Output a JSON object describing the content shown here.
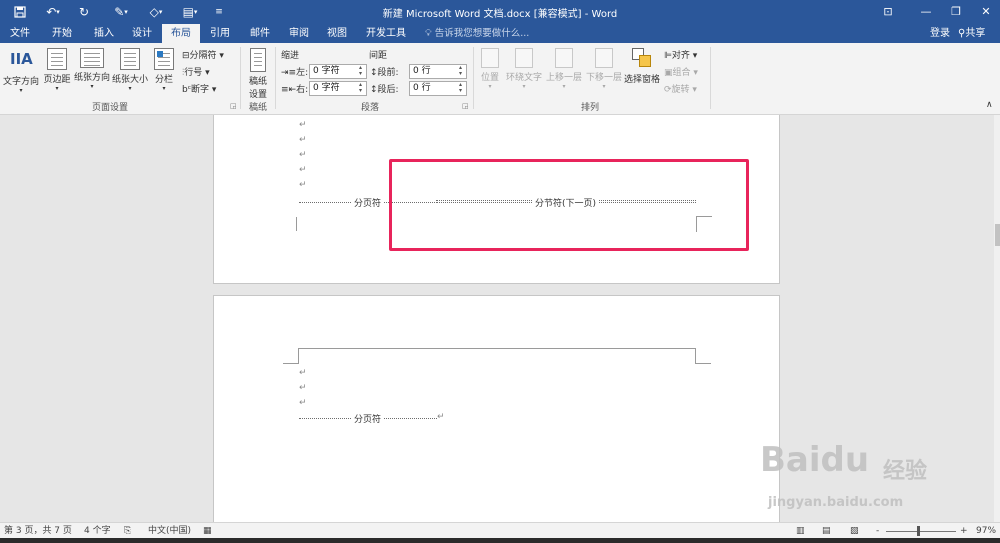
{
  "window": {
    "title": "新建 Microsoft Word 文档.docx [兼容模式] - Word",
    "quick_access": [
      "save-icon",
      "undo-icon",
      "redo-icon",
      "format-painter-icon",
      "shape-icon",
      "layout-icon",
      "customize-icon"
    ]
  },
  "tabs": [
    "文件",
    "开始",
    "插入",
    "设计",
    "布局",
    "引用",
    "邮件",
    "审阅",
    "视图",
    "开发工具"
  ],
  "active_tab": "布局",
  "tell_me": "告诉我您想要做什么...",
  "account": {
    "login": "登录",
    "share": "共享"
  },
  "ribbon": {
    "page_setup": {
      "label": "页面设置",
      "buttons": [
        "文字方向",
        "页边距",
        "纸张方向",
        "纸张大小",
        "分栏"
      ],
      "small": [
        "分隔符",
        "行号",
        "断字"
      ]
    },
    "manuscript": {
      "label": "稿纸",
      "button_line1": "稿纸",
      "button_line2": "设置"
    },
    "paragraph": {
      "label": "段落",
      "indent_header": "缩进",
      "spacing_header": "间距",
      "left_label": "左:",
      "right_label": "右:",
      "before_label": "段前:",
      "after_label": "段后:",
      "left_value": "0 字符",
      "right_value": "0 字符",
      "before_value": "0 行",
      "after_value": "0 行"
    },
    "arrange": {
      "label": "排列",
      "buttons": [
        "位置",
        "环绕文字",
        "上移一层",
        "下移一层",
        "选择窗格"
      ],
      "small": [
        "对齐",
        "组合",
        "旋转"
      ]
    }
  },
  "document": {
    "page_break": "分页符",
    "section_break": "分节符(下一页)",
    "paragraph_mark": "↵"
  },
  "status": {
    "page": "第 3 页，共 7 页",
    "words": "4 个字",
    "language": "中文(中国)",
    "zoom": "97%",
    "zoom_minus": "-",
    "zoom_plus": "+"
  },
  "watermark": {
    "brand": "Baidu",
    "cn": "经验",
    "url": "jingyan.baidu.com"
  }
}
